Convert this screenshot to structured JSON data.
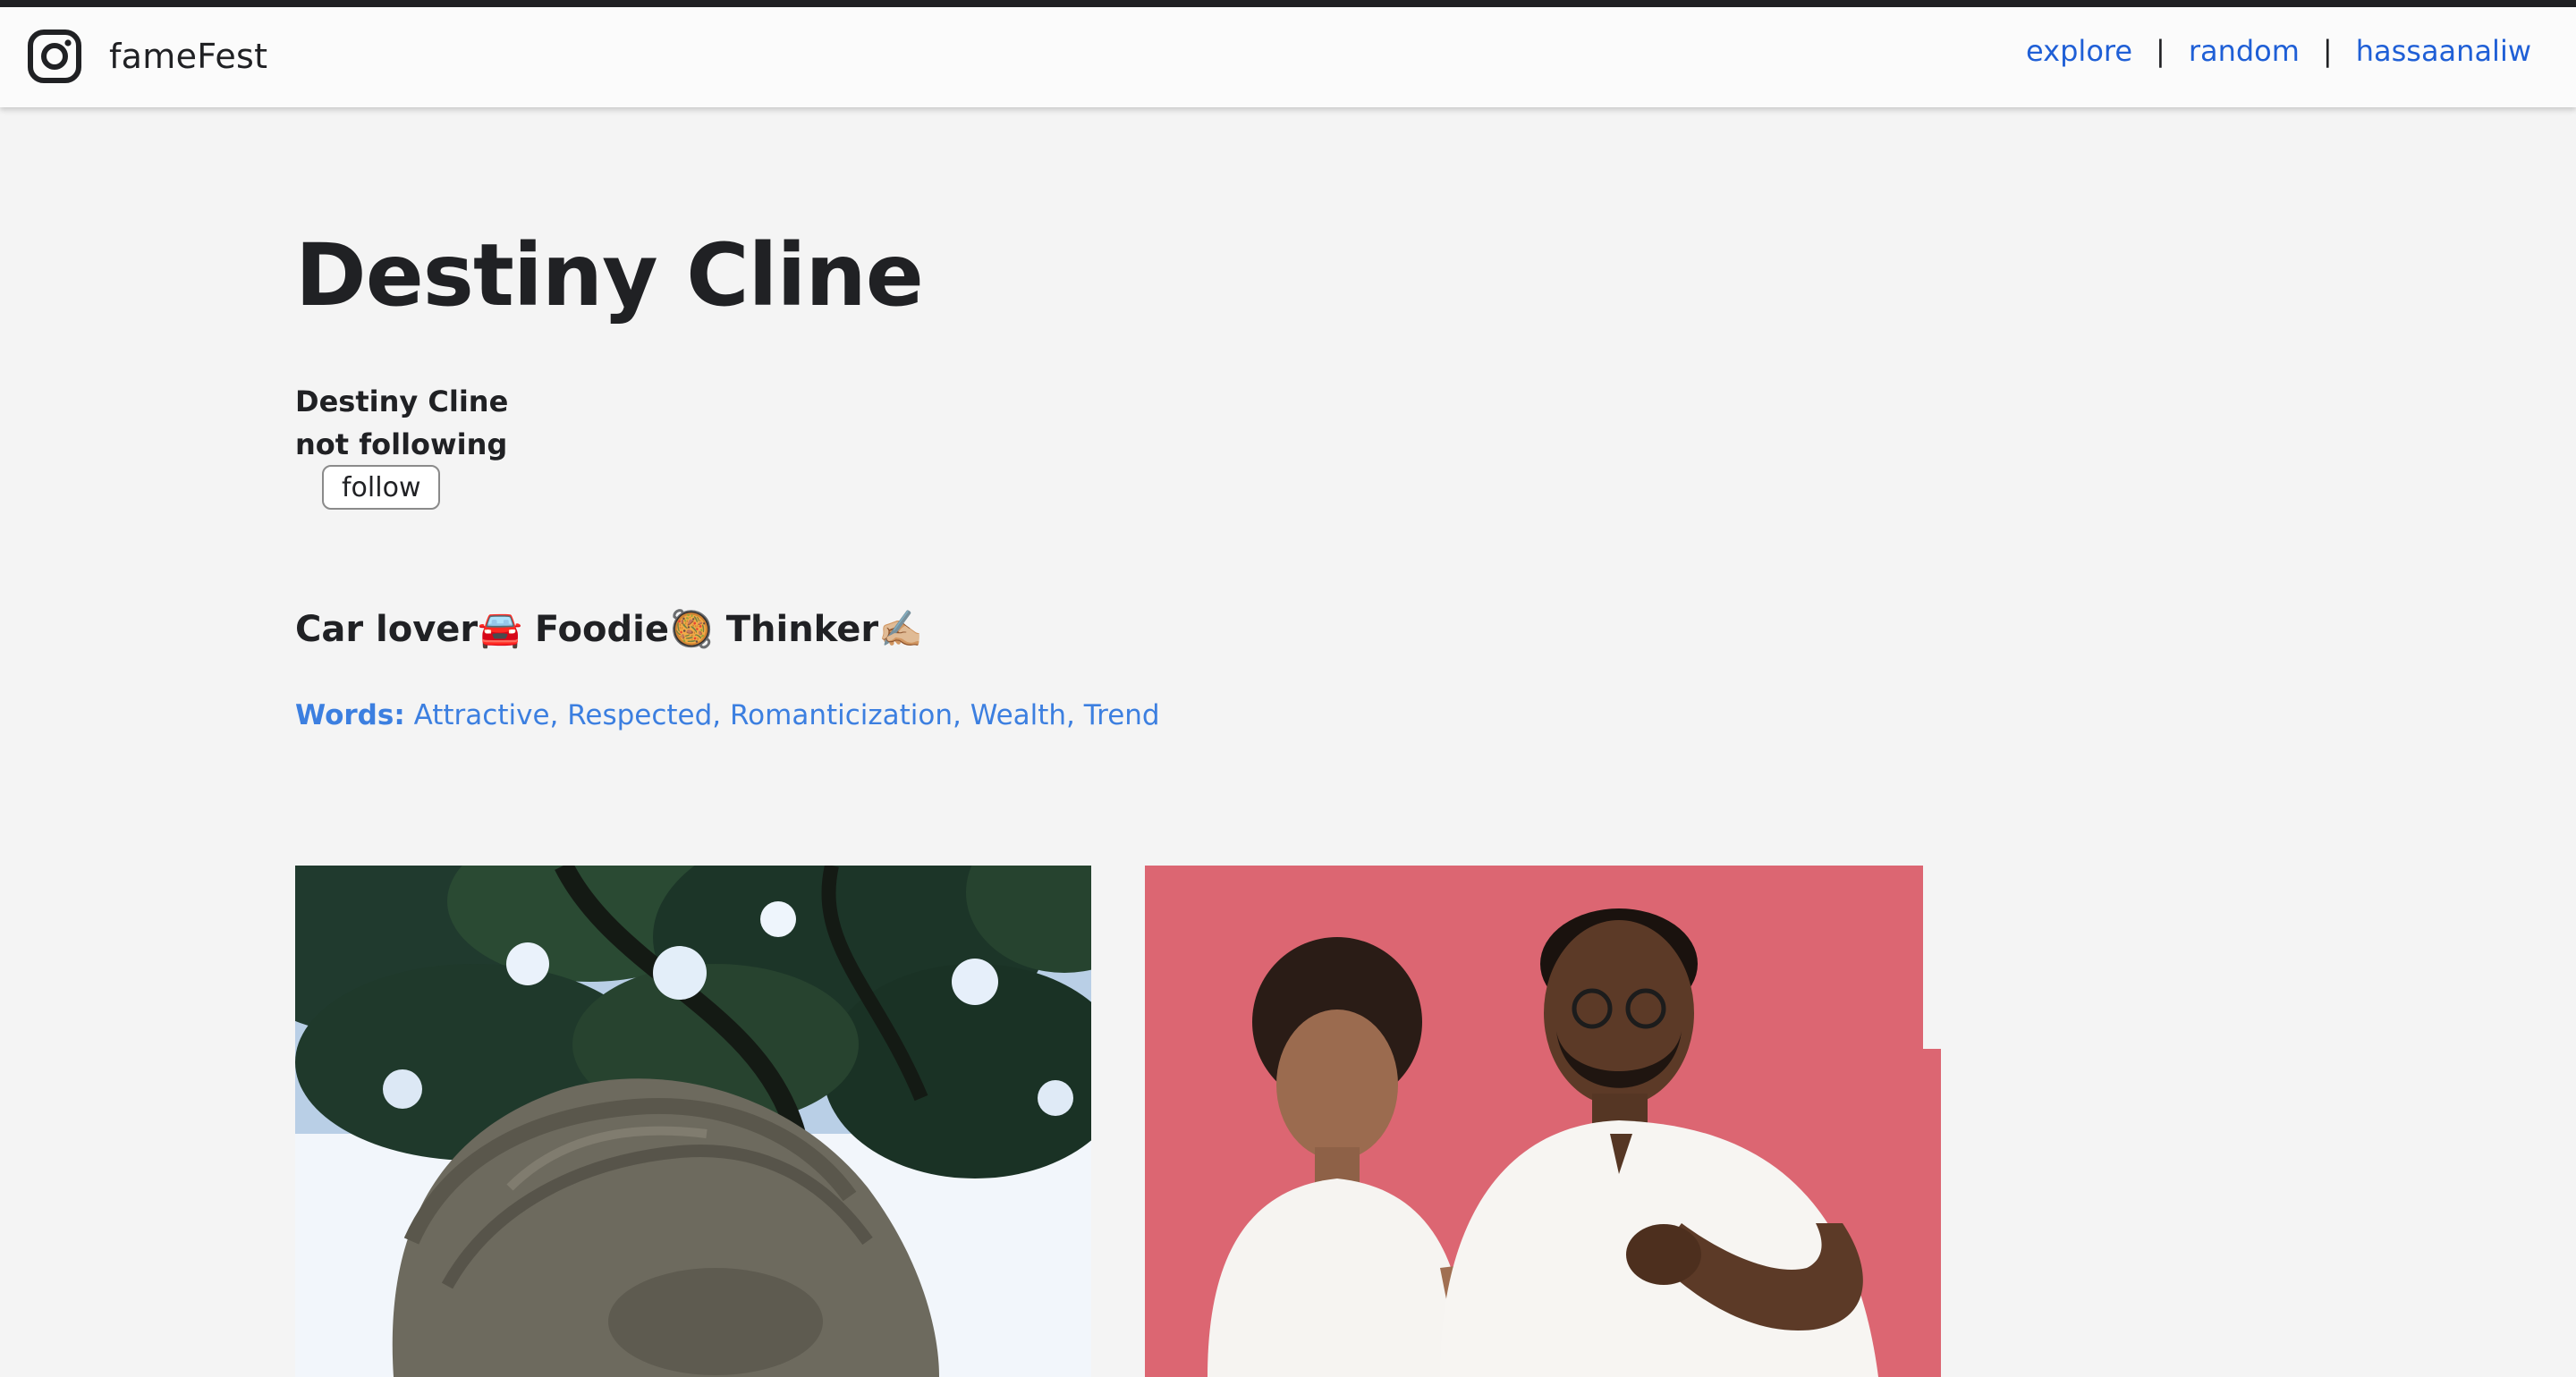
{
  "app": {
    "name": "fameFest",
    "logo_icon": "camera-icon"
  },
  "nav": {
    "links": [
      "explore",
      "random",
      "hassaanaliw"
    ],
    "separator": "|",
    "link_color": "#1f5fd6"
  },
  "profile": {
    "title": "Destiny Cline",
    "display_name": "Destiny Cline",
    "follow_status": "not following",
    "follow_button_label": "follow",
    "bio": "Car lover🚘 Foodie🥘 Thinker✍🏼",
    "words_label": "Words:",
    "words": "Attractive, Respected, Romanticization, Wealth, Trend",
    "words_color": "#3c7fe0"
  },
  "posts": [
    {
      "subject": "stone statue head under tree canopy"
    },
    {
      "subject": "man and girl fist bump on pink background"
    }
  ]
}
